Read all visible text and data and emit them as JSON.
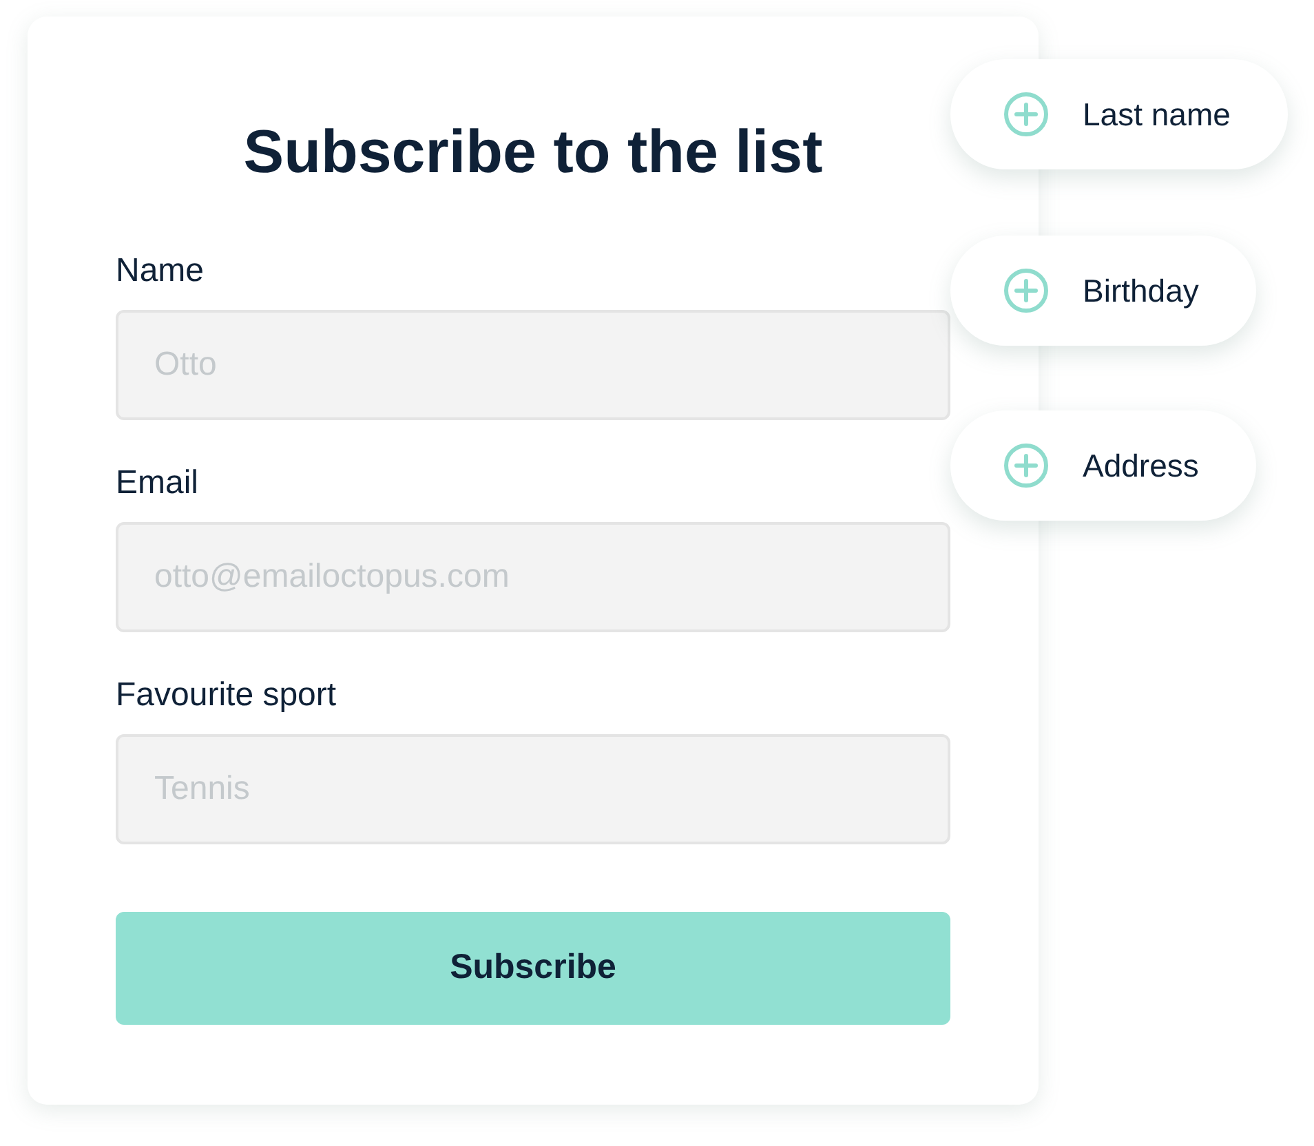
{
  "form": {
    "title": "Subscribe to the list",
    "fields": [
      {
        "label": "Name",
        "placeholder": "Otto"
      },
      {
        "label": "Email",
        "placeholder": "otto@emailoctopus.com"
      },
      {
        "label": "Favourite sport",
        "placeholder": "Tennis"
      }
    ],
    "button": "Subscribe"
  },
  "add_field_options": [
    {
      "label": "Last name"
    },
    {
      "label": "Birthday"
    },
    {
      "label": "Address"
    }
  ]
}
